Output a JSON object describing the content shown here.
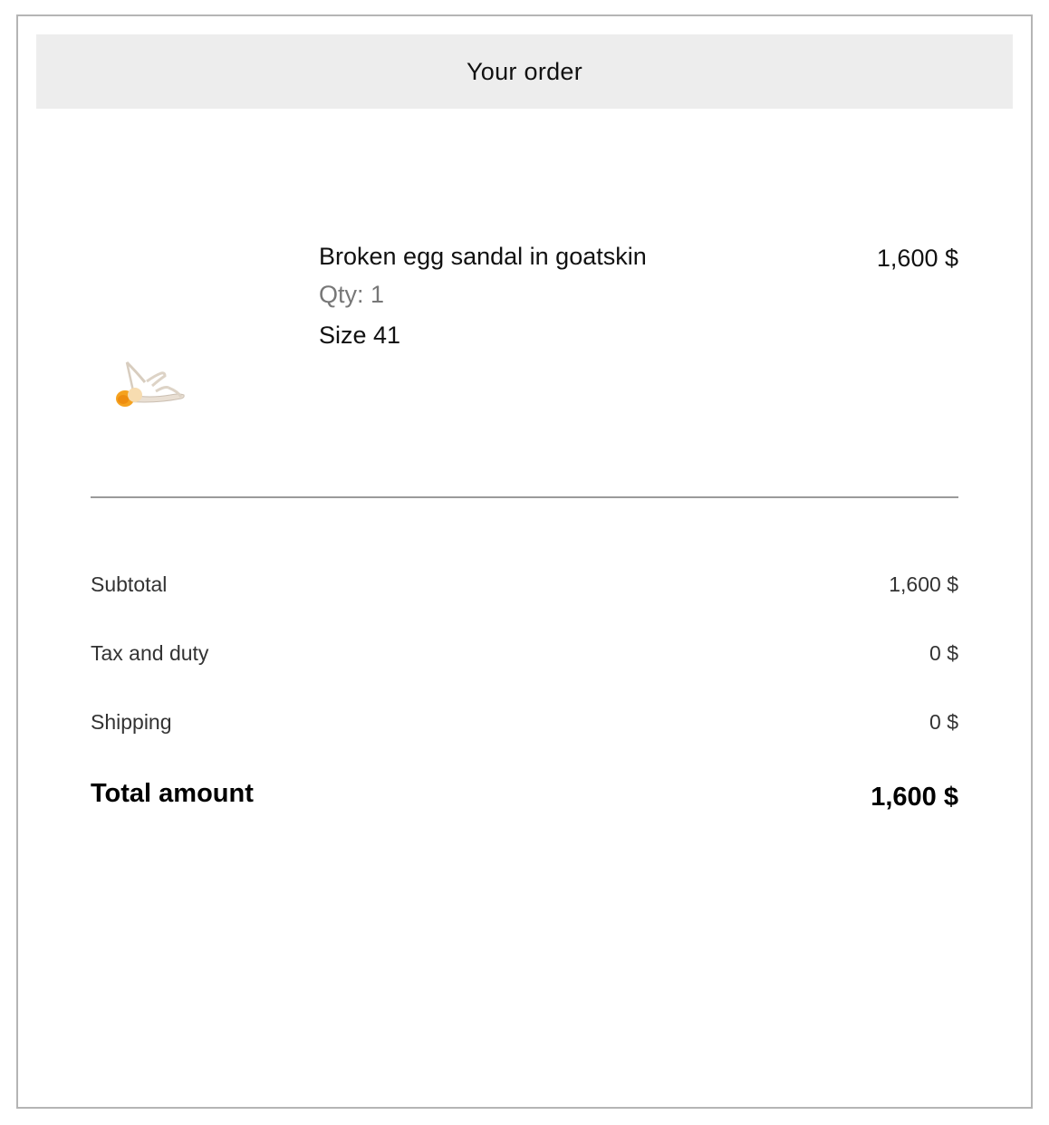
{
  "header": {
    "title": "Your order"
  },
  "item": {
    "name": "Broken egg sandal in goatskin",
    "qty": "Qty: 1",
    "size": "Size 41",
    "price": "1,600 $",
    "image_icon": "sandal-product-image"
  },
  "summary": {
    "subtotal": {
      "label": "Subtotal",
      "value": "1,600 $"
    },
    "tax": {
      "label": "Tax and duty",
      "value": "0 $"
    },
    "shipping": {
      "label": "Shipping",
      "value": "0 $"
    },
    "total": {
      "label": "Total amount",
      "value": "1,600 $"
    }
  },
  "colors": {
    "header_bg": "#ededed",
    "frame_border": "#b5b5b5",
    "divider": "#9a9a9a",
    "muted_text": "#777777",
    "egg_yolk": "#f5a21f"
  }
}
